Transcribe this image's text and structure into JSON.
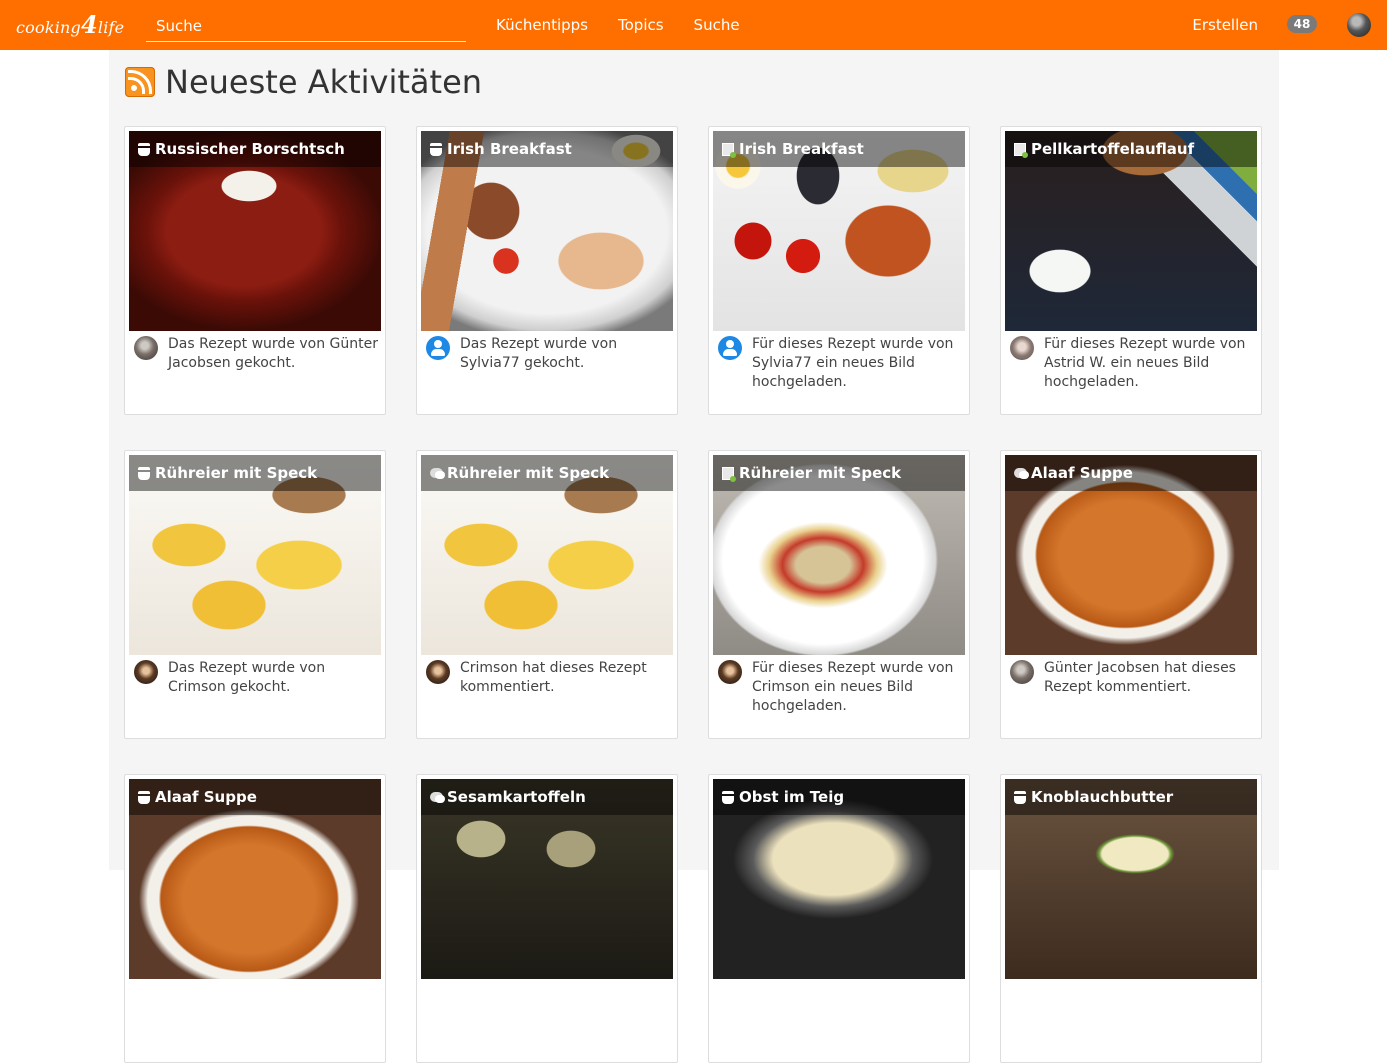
{
  "navbar": {
    "logo_left": "cooking",
    "logo_num": "4",
    "logo_right": "life",
    "search_placeholder": "Suche",
    "links": [
      "Küchentipps",
      "Topics",
      "Suche"
    ],
    "create_label": "Erstellen",
    "notification_count": "48",
    "brand_color": "#ff6f00"
  },
  "page": {
    "title": "Neueste Aktivitäten",
    "icon": "rss-icon"
  },
  "activities": [
    {
      "title": "Russischer Borschtsch",
      "type": "cooked",
      "desc": "Das Rezept wurde von Günter Jacobsen gekocht."
    },
    {
      "title": "Irish Breakfast",
      "type": "cooked",
      "desc": "Das Rezept wurde von Sylvia77 gekocht."
    },
    {
      "title": "Irish Breakfast",
      "type": "photo",
      "desc": "Für dieses Rezept wurde von Sylvia77 ein neues Bild hochgeladen."
    },
    {
      "title": "Pellkartoffelauflauf",
      "type": "photo",
      "desc": "Für dieses Rezept wurde von Astrid W. ein neues Bild hochgeladen."
    },
    {
      "title": "Rühreier mit Speck",
      "type": "cooked",
      "desc": "Das Rezept wurde von Crimson gekocht."
    },
    {
      "title": "Rühreier mit Speck",
      "type": "comment",
      "desc": "Crimson hat dieses Rezept kommentiert."
    },
    {
      "title": "Rühreier mit Speck",
      "type": "photo",
      "desc": "Für dieses Rezept wurde von Crimson ein neues Bild hochgeladen."
    },
    {
      "title": "Alaaf Suppe",
      "type": "comment",
      "desc": "Günter Jacobsen hat dieses Rezept kommentiert."
    },
    {
      "title": "Alaaf Suppe",
      "type": "cooked",
      "desc": ""
    },
    {
      "title": "Sesamkartoffeln",
      "type": "comment",
      "desc": ""
    },
    {
      "title": "Obst im Teig",
      "type": "cooked",
      "desc": ""
    },
    {
      "title": "Knoblauchbutter",
      "type": "cooked",
      "desc": ""
    }
  ]
}
